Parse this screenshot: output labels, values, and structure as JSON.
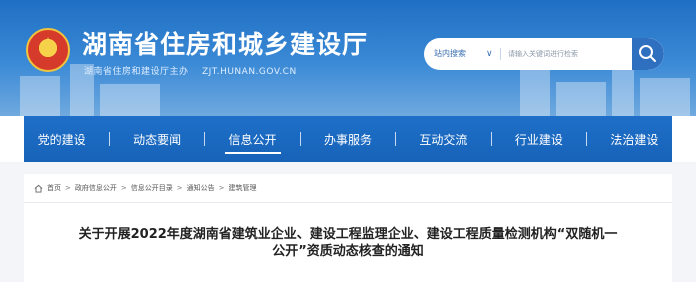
{
  "header": {
    "title": "湖南省住房和城乡建设厅",
    "subtitle": "湖南省住房和建设厅主办",
    "domain": "ZJT.HUNAN.GOV.CN"
  },
  "search": {
    "scope_label": "站内搜索",
    "placeholder": "请输入关键词进行检索",
    "button_icon": "search-icon"
  },
  "nav": {
    "items": [
      {
        "label": "党的建设"
      },
      {
        "label": "动态要闻"
      },
      {
        "label": "信息公开"
      },
      {
        "label": "办事服务"
      },
      {
        "label": "互动交流"
      },
      {
        "label": "行业建设"
      },
      {
        "label": "法治建设"
      }
    ],
    "active_index": 2
  },
  "breadcrumb": {
    "home_icon": "home-icon",
    "items": [
      "首页",
      "政府信息公开",
      "信息公开目录",
      "通知公告",
      "建筑管理"
    ],
    "separator": ">"
  },
  "article": {
    "title_line1": "关于开展2022年度湖南省建筑业企业、建设工程监理企业、建设工程质量检测机构“双随机一",
    "title_line2": "公开”资质动态核查的通知"
  },
  "colors": {
    "header_blue": "#1f6fc4",
    "nav_blue": "#1763b8",
    "search_button": "#2f6fc0"
  }
}
